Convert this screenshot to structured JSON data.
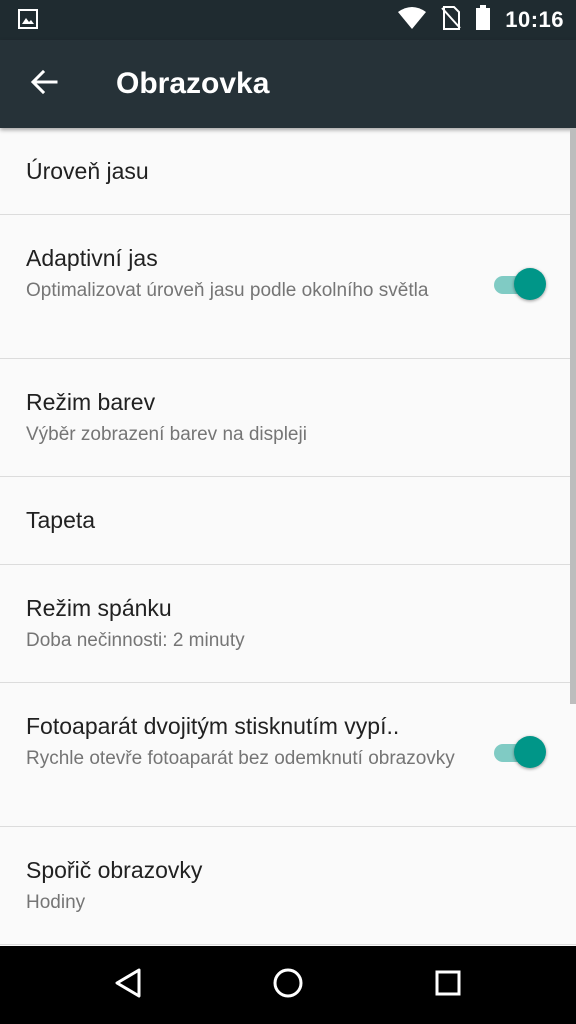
{
  "status_bar": {
    "time": "10:16",
    "icons": [
      "image-notification-icon",
      "wifi-icon",
      "no-sim-icon",
      "battery-icon"
    ]
  },
  "app_bar": {
    "title": "Obrazovka",
    "back_icon": "arrow-left-icon"
  },
  "settings": [
    {
      "title": "Úroveň jasu"
    },
    {
      "title": "Adaptivní jas",
      "summary": "Optimalizovat úroveň jasu podle okolního světla",
      "switch_on": true
    },
    {
      "title": "Režim barev",
      "summary": "Výběr zobrazení barev na displeji"
    },
    {
      "title": "Tapeta"
    },
    {
      "title": "Režim spánku",
      "summary": "Doba nečinnosti: 2 minuty"
    },
    {
      "title": "Fotoaparát dvojitým stisknutím vypí..",
      "summary": "Rychle otevře fotoaparát bez odemknutí obrazovky",
      "switch_on": true
    },
    {
      "title": "Spořič obrazovky",
      "summary": "Hodiny"
    }
  ],
  "nav_bar": {
    "buttons": [
      "back-triangle-icon",
      "home-circle-icon",
      "recents-square-icon"
    ]
  },
  "colors": {
    "app_bar": "#263238",
    "status_bar": "#1f2b30",
    "accent": "#009688",
    "accent_track": "#80cbc4"
  }
}
